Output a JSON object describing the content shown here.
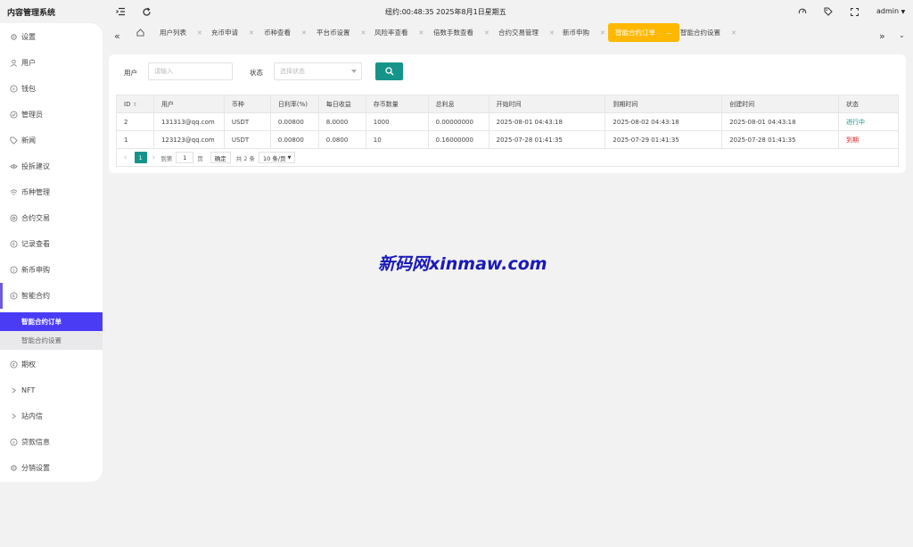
{
  "app": {
    "title": "内容管理系统"
  },
  "header": {
    "clock": "纽约:00:48:35 2025年8月1日星期五",
    "user": "admin"
  },
  "sidebar": {
    "items": [
      {
        "label": "设置",
        "icon": "gear-icon"
      },
      {
        "label": "用户",
        "icon": "user-icon"
      },
      {
        "label": "钱包",
        "icon": "wallet-icon"
      },
      {
        "label": "管理员",
        "icon": "shield-icon"
      },
      {
        "label": "新闻",
        "icon": "tag-icon"
      },
      {
        "label": "投拆建议",
        "icon": "eye-icon"
      },
      {
        "label": "币种管理",
        "icon": "coin-icon"
      },
      {
        "label": "合约交易",
        "icon": "contract-icon"
      },
      {
        "label": "记录查看",
        "icon": "record-icon"
      },
      {
        "label": "新币申购",
        "icon": "new-coin-icon"
      },
      {
        "label": "智能合约",
        "icon": "smart-contract-icon"
      },
      {
        "label": "期权",
        "icon": "option-icon"
      },
      {
        "label": "NFT",
        "icon": "nft-icon"
      },
      {
        "label": "站内信",
        "icon": "message-icon"
      },
      {
        "label": "贷款信息",
        "icon": "loan-icon"
      },
      {
        "label": "分销设置",
        "icon": "distribution-icon"
      }
    ],
    "sub_items": [
      {
        "label": "智能合约订单"
      },
      {
        "label": "智能合约设置"
      }
    ]
  },
  "tabs": [
    {
      "label": "用户列表"
    },
    {
      "label": "充币申请"
    },
    {
      "label": "币种查看"
    },
    {
      "label": "平台币设置"
    },
    {
      "label": "风险率查看"
    },
    {
      "label": "倍数手数查看"
    },
    {
      "label": "合约交易管理"
    },
    {
      "label": "新币申购"
    },
    {
      "label": "智能合约订单"
    },
    {
      "label": "智能合约设置"
    }
  ],
  "filters": {
    "user_label": "用户",
    "user_placeholder": "请输入",
    "status_label": "状态",
    "status_placeholder": "选择状态"
  },
  "table": {
    "columns": [
      "ID",
      "用户",
      "币种",
      "日利率(%)",
      "每日收益",
      "存币数量",
      "总利息",
      "开始时间",
      "到期时间",
      "创建时间",
      "状态"
    ],
    "rows": [
      [
        "2",
        "131313@qq.com",
        "USDT",
        "0.00800",
        "8.0000",
        "1000",
        "0.00000000",
        "2025-08-01 04:43:18",
        "2025-08-02 04:43:18",
        "2025-08-01 04:43:18",
        "进行中"
      ],
      [
        "1",
        "123123@qq.com",
        "USDT",
        "0.00800",
        "0.0800",
        "10",
        "0.16000000",
        "2025-07-28 01:41:35",
        "2025-07-29 01:41:35",
        "2025-07-28 01:41:35",
        "到期"
      ]
    ]
  },
  "pager": {
    "prev": "‹",
    "current": "1",
    "next": "›",
    "goto": "到第",
    "page_input": "1",
    "page_unit": "页",
    "confirm": "确定",
    "total": "共 2 条",
    "page_size": "10 条/页"
  },
  "watermark": "新码网xinmaw.com",
  "colors": {
    "accent": "#16948a",
    "active_tab": "#ffb800",
    "active_menu": "#4a3cf5",
    "expired": "#e0252c"
  }
}
